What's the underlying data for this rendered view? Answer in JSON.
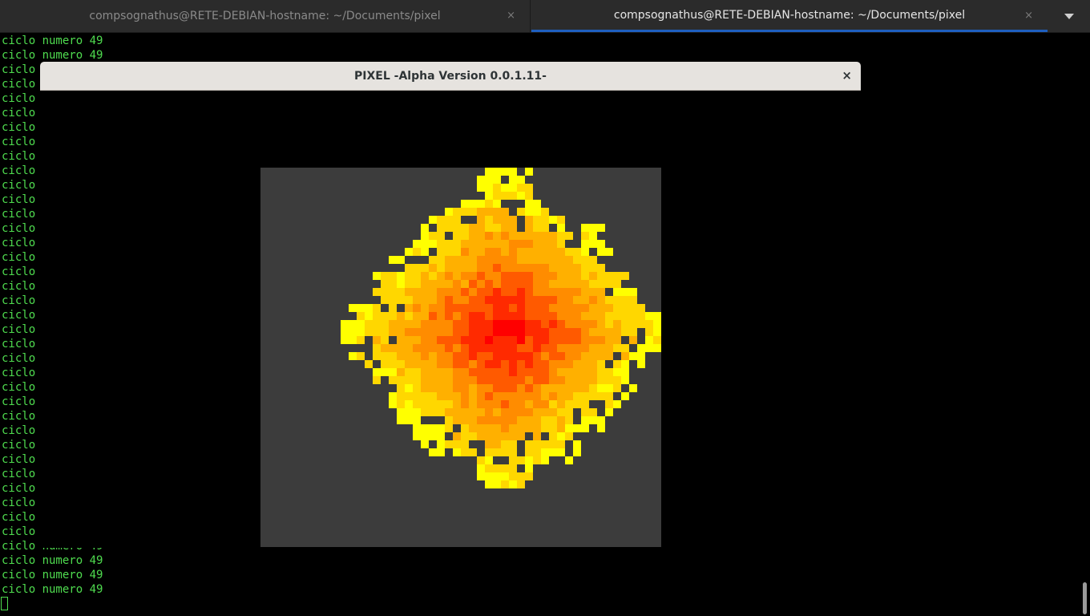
{
  "tabs": [
    {
      "title": "compsognathus@RETE-DEBIAN-hostname: ~/Documents/pixel",
      "active": false,
      "close_icon": "×"
    },
    {
      "title": "compsognathus@RETE-DEBIAN-hostname: ~/Documents/pixel",
      "active": true,
      "close_icon": "×"
    }
  ],
  "terminal": {
    "full_line": "ciclo numero 49",
    "short_line": "ciclo",
    "cursor": "block"
  },
  "window": {
    "title": "PIXEL -Alpha Version 0.0.1.11-",
    "close_icon": "×",
    "canvas_background": "#3c3c3c",
    "palette": [
      "#ffff00",
      "#ffd700",
      "#ffb000",
      "#ff8c00",
      "#ff5a00",
      "#ff2a00",
      "#ff0000"
    ]
  },
  "icons": {
    "tab_menu": "chevron-down-icon",
    "tab_close": "close-icon",
    "window_close": "close-icon"
  }
}
